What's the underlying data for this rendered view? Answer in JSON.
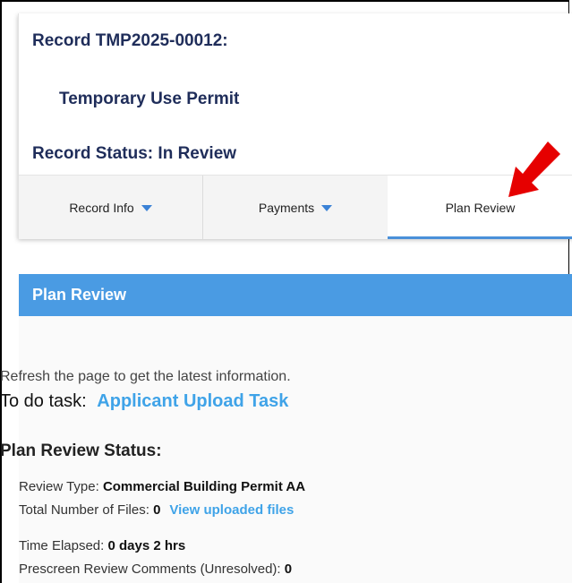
{
  "record": {
    "id_line": "Record TMP2025-00012:",
    "type": "Temporary Use Permit",
    "status_line": "Record Status: In Review"
  },
  "tabs": [
    {
      "label": "Record Info",
      "has_dropdown": true
    },
    {
      "label": "Payments",
      "has_dropdown": true
    },
    {
      "label": "Plan Review",
      "has_dropdown": false,
      "active": true
    }
  ],
  "section": {
    "title": "Plan Review",
    "refresh_text": "Refresh the page to get the latest information.",
    "todo_label": "To do task:",
    "todo_link": "Applicant Upload Task",
    "status_heading": "Plan Review Status:",
    "review_type_label": "Review Type: ",
    "review_type_value": "Commercial Building Permit AA",
    "files_label": "Total Number of Files: ",
    "files_value": "0",
    "files_link": "View uploaded files",
    "time_label": "Time Elapsed: ",
    "time_value": "0 days 2 hrs",
    "prescreen_label": "Prescreen Review Comments (Unresolved): ",
    "prescreen_value": "0"
  },
  "colors": {
    "accent": "#4a9be3",
    "link": "#3fa3e8",
    "heading": "#1f2d5a",
    "annotation_arrow": "#e60000"
  },
  "icons": {
    "dropdown": "caret-down-icon",
    "annotation": "red-arrow-icon"
  }
}
